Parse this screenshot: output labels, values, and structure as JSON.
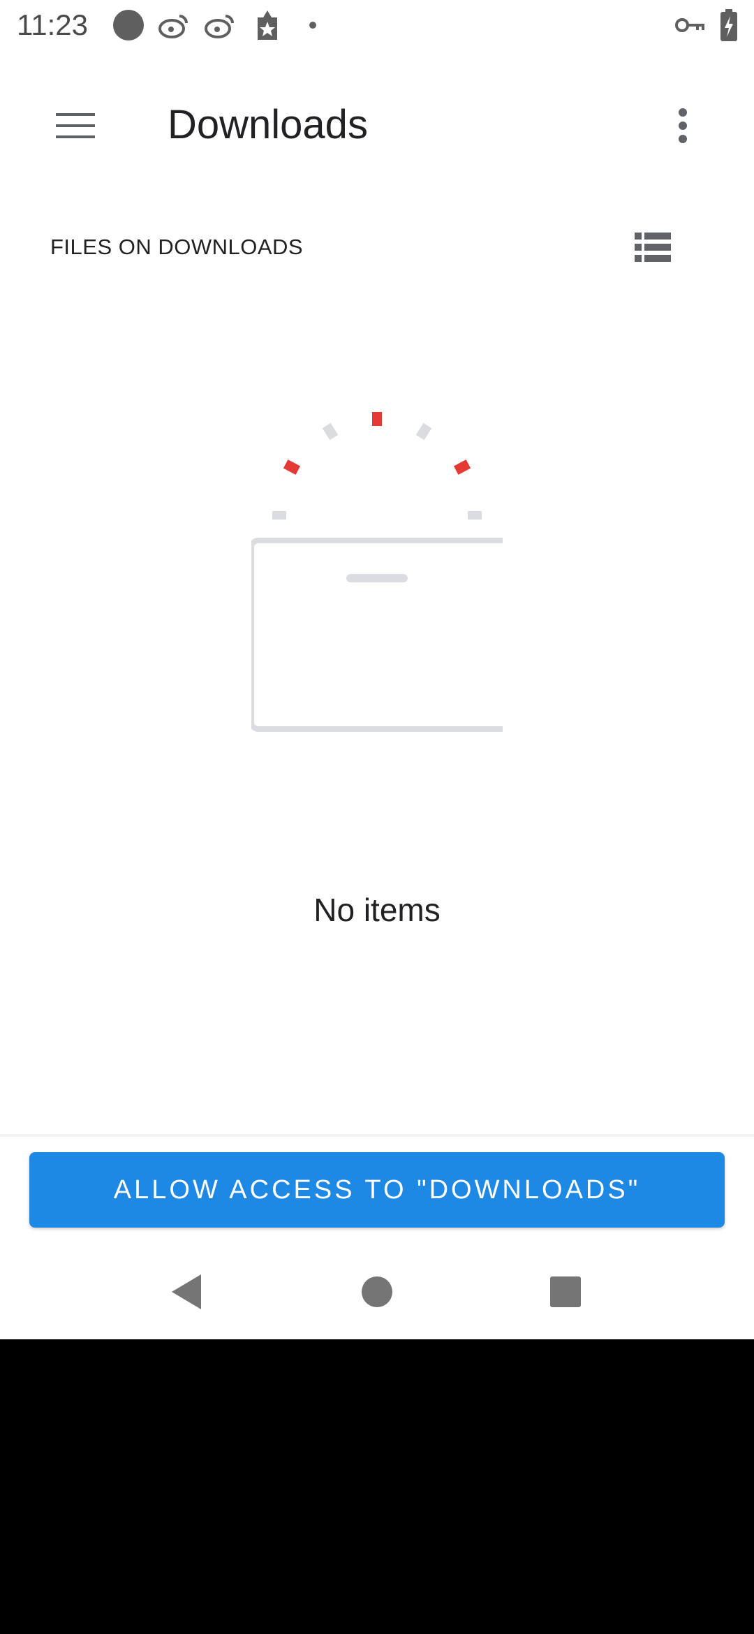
{
  "status_bar": {
    "time": "11:23",
    "icons": [
      "dot-icon",
      "weibo-icon",
      "weibo-icon",
      "store-badge-icon",
      "small-dot-icon",
      "vpn-key-icon",
      "battery-charging-icon"
    ]
  },
  "app_bar": {
    "title": "Downloads",
    "menu_icon": "hamburger-menu-icon",
    "overflow_icon": "more-vert-icon"
  },
  "section": {
    "title": "FILES ON DOWNLOADS",
    "view_icon": "list-view-icon"
  },
  "empty_state": {
    "message": "No items",
    "accent_color": "#e53935",
    "neutral_color": "#dadce0"
  },
  "action": {
    "label": "ALLOW ACCESS TO \"DOWNLOADS\"",
    "color": "#1e88e5"
  },
  "nav_bar": {
    "icons": [
      "back-icon",
      "home-icon",
      "recents-icon"
    ]
  }
}
